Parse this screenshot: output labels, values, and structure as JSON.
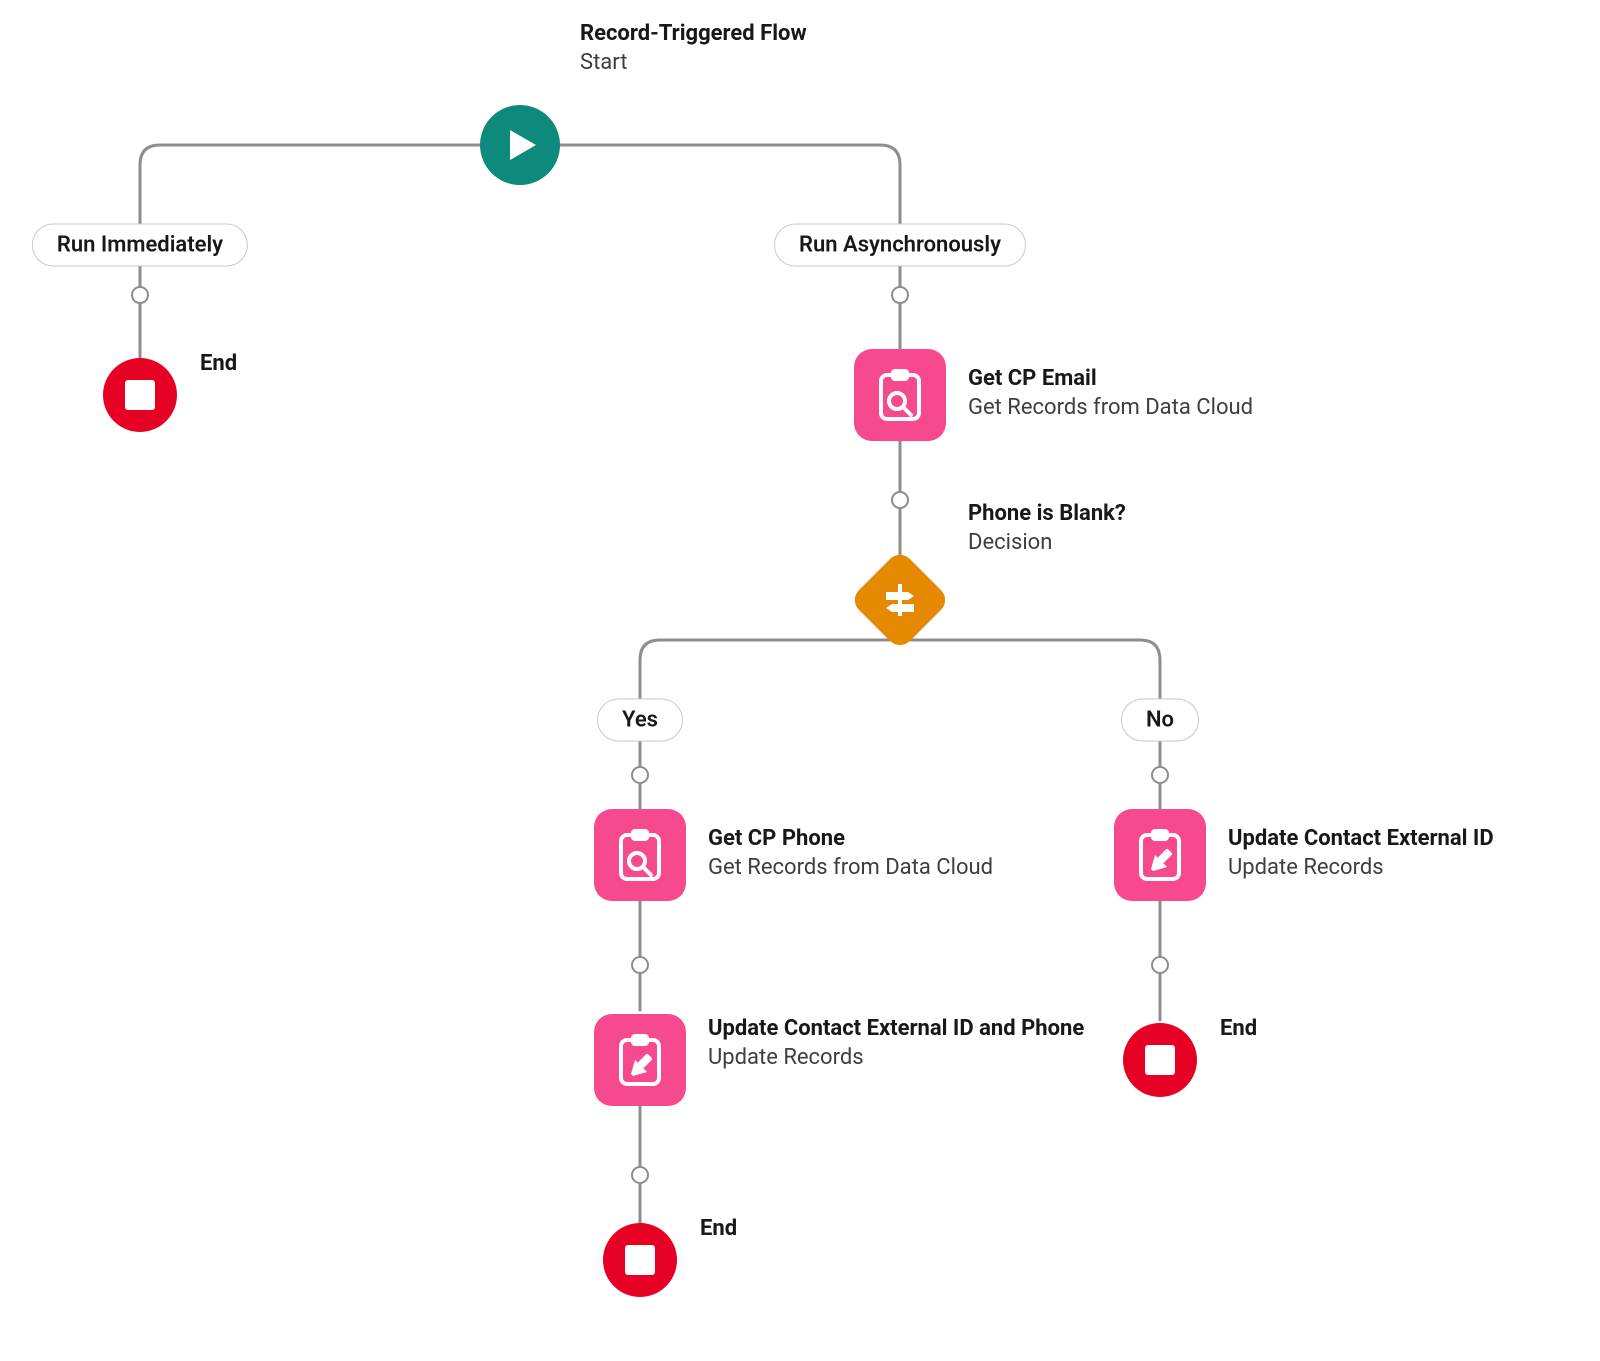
{
  "start": {
    "title": "Record-Triggered Flow",
    "sub": "Start"
  },
  "branches": {
    "run_immediately": "Run Immediately",
    "run_async": "Run Asynchronously",
    "yes": "Yes",
    "no": "No"
  },
  "nodes": {
    "get_cp_email": {
      "title": "Get CP Email",
      "sub": "Get Records from Data Cloud"
    },
    "decision_phone_blank": {
      "title": "Phone is Blank?",
      "sub": "Decision"
    },
    "get_cp_phone": {
      "title": "Get CP Phone",
      "sub": "Get Records from Data Cloud"
    },
    "update_contact_phone": {
      "title": "Update Contact External ID and Phone",
      "sub": "Update Records"
    },
    "update_contact_ext": {
      "title": "Update Contact External ID",
      "sub": "Update Records"
    }
  },
  "end_label": "End",
  "colors": {
    "teal": "#0e8a7d",
    "pink": "#f7498e",
    "orange": "#e58a00",
    "red": "#e60023",
    "line": "#8e8e8e"
  }
}
